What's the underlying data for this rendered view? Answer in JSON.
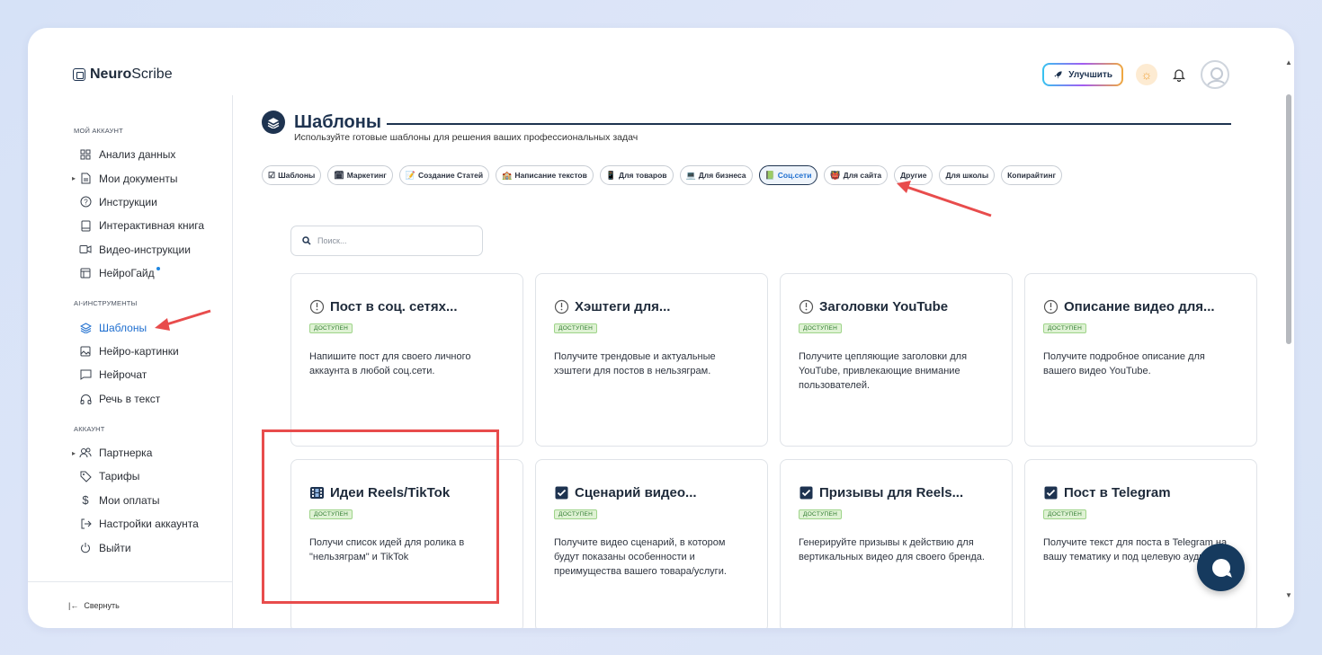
{
  "brand": {
    "name_bold": "Neuro",
    "name_light": "Scribe"
  },
  "header": {
    "upgrade_label": "Улучшить"
  },
  "sidebar": {
    "sections": [
      {
        "title": "МОЙ АККАУНТ",
        "items": [
          {
            "label": "Анализ данных",
            "icon": "grid-icon"
          },
          {
            "label": "Мои документы",
            "icon": "document-icon",
            "expandable": true
          },
          {
            "label": "Инструкции",
            "icon": "question-icon"
          },
          {
            "label": "Интерактивная книга",
            "icon": "book-icon"
          },
          {
            "label": "Видео-инструкции",
            "icon": "video-icon"
          },
          {
            "label": "НейроГайд",
            "icon": "table-icon",
            "dot": true
          }
        ]
      },
      {
        "title": "AI-ИНСТРУМЕНТЫ",
        "items": [
          {
            "label": "Шаблоны",
            "icon": "layers-icon",
            "active": true
          },
          {
            "label": "Нейро-картинки",
            "icon": "image-icon"
          },
          {
            "label": "Нейрочат",
            "icon": "chat-icon"
          },
          {
            "label": "Речь в текст",
            "icon": "headphones-icon"
          }
        ]
      },
      {
        "title": "АККАУНТ",
        "items": [
          {
            "label": "Партнерка",
            "icon": "users-icon",
            "expandable": true
          },
          {
            "label": "Тарифы",
            "icon": "tag-icon"
          },
          {
            "label": "Мои оплаты",
            "icon": "dollar-icon"
          },
          {
            "label": "Настройки аккаунта",
            "icon": "login-icon"
          },
          {
            "label": "Выйти",
            "icon": "power-icon"
          }
        ]
      }
    ],
    "collapse_label": "Свернуть"
  },
  "main": {
    "title": "Шаблоны",
    "subtitle": "Используйте готовые шаблоны для решения ваших профессиональных задач",
    "chips": [
      {
        "label": "Шаблоны",
        "emoji": "☑"
      },
      {
        "label": "Маркетинг",
        "emoji": "🗓"
      },
      {
        "label": "Создание Статей",
        "emoji": "📝"
      },
      {
        "label": "Написание текстов",
        "emoji": "🏫"
      },
      {
        "label": "Для товаров",
        "emoji": "📱"
      },
      {
        "label": "Для бизнеса",
        "emoji": "💻"
      },
      {
        "label": "Соц.сети",
        "emoji": "📗",
        "active": true
      },
      {
        "label": "Для сайта",
        "emoji": "👹"
      },
      {
        "label": "Другие",
        "emoji": ""
      },
      {
        "label": "Для школы",
        "emoji": ""
      },
      {
        "label": "Копирайтинг",
        "emoji": ""
      }
    ],
    "search_placeholder": "Поиск...",
    "cards": [
      {
        "title": "Пост в соц. сетях...",
        "icon": "clock-icon",
        "badge": "ДОСТУПЕН",
        "desc": "Напишите пост для своего личного аккаунта в любой соц.сети."
      },
      {
        "title": "Хэштеги для...",
        "icon": "clock-icon",
        "badge": "ДОСТУПЕН",
        "desc": "Получите трендовые и актуальные хэштеги для постов в нельзяграм."
      },
      {
        "title": "Заголовки YouTube",
        "icon": "clock-icon",
        "badge": "ДОСТУПЕН",
        "desc": "Получите цепляющие заголовки для YouTube, привлекающие внимание пользователей."
      },
      {
        "title": "Описание видео для...",
        "icon": "clock-icon",
        "badge": "ДОСТУПЕН",
        "desc": "Получите подробное описание для вашего видео YouTube."
      },
      {
        "title": "Идеи Reels/TikTok",
        "icon": "film-icon",
        "badge": "ДОСТУПЕН",
        "desc": "Получи список идей для ролика в \"нельзяграм\" и TikTok"
      },
      {
        "title": "Сценарий видео...",
        "icon": "checkbox-icon",
        "badge": "ДОСТУПЕН",
        "desc": "Получите видео сценарий, в котором будут показаны особенности и преимущества вашего товара/услуги."
      },
      {
        "title": "Призывы для Reels...",
        "icon": "checkbox-icon",
        "badge": "ДОСТУПЕН",
        "desc": "Генерируйте призывы к действию для вертикальных видео для своего бренда."
      },
      {
        "title": "Пост в Telegram",
        "icon": "checkbox-icon",
        "badge": "ДОСТУПЕН",
        "desc": "Получите текст для поста в Telegram на вашу тематику и под целевую аудиторию."
      }
    ]
  },
  "colors": {
    "accent": "#1f6fd0",
    "dark": "#1e3350",
    "annotation_red": "#e84c4c",
    "badge_green": "#dff2d4"
  }
}
